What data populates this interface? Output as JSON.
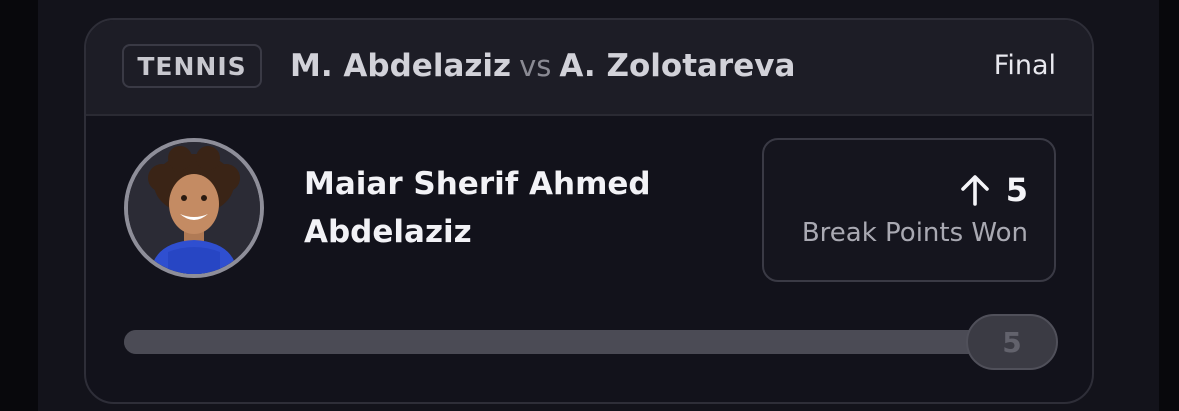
{
  "header": {
    "sport": "TENNIS",
    "player_a": "M. Abdelaziz",
    "vs": "vs",
    "player_b": "A. Zolotareva",
    "status": "Final"
  },
  "player": {
    "name_line1": "Maiar Sherif Ahmed",
    "name_line2": "Abdelaziz",
    "avatar_icon": "player-photo"
  },
  "stat": {
    "trend_icon": "arrow-up-icon",
    "value": "5",
    "label": "Break Points Won"
  },
  "progress": {
    "value": "5",
    "fill_fraction": 1.0
  }
}
